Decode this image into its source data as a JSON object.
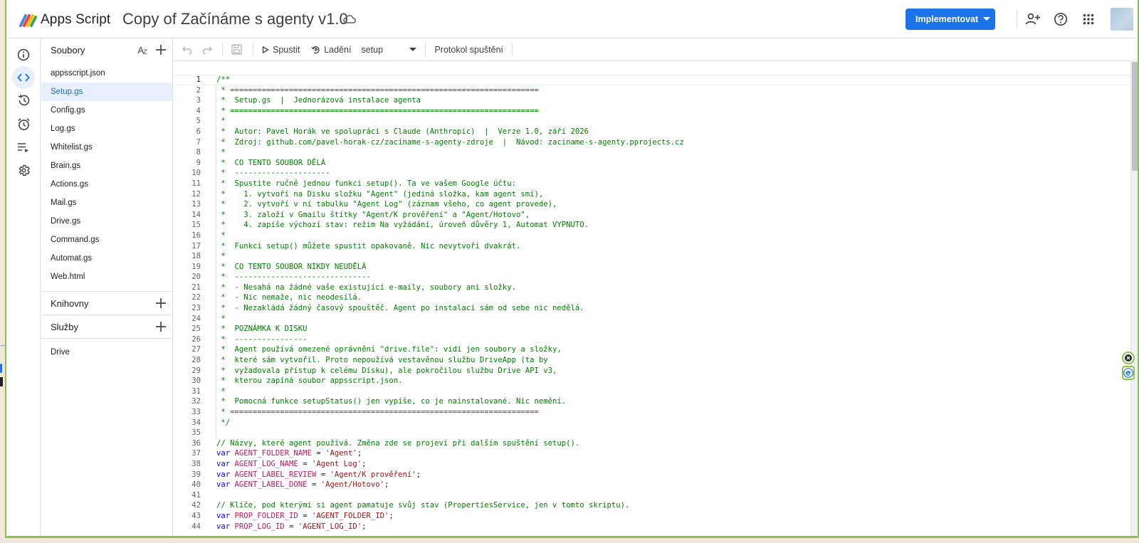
{
  "header": {
    "brand": "Apps Script",
    "project_title": "Copy of Začínáme s agenty v1.0",
    "deploy_label": "Implementovat"
  },
  "files_panel": {
    "title": "Soubory",
    "files": [
      "appsscript.json",
      "Setup.gs",
      "Config.gs",
      "Log.gs",
      "Whitelist.gs",
      "Brain.gs",
      "Actions.gs",
      "Mail.gs",
      "Drive.gs",
      "Command.gs",
      "Automat.gs",
      "Web.html"
    ],
    "active_file": "Setup.gs",
    "libraries_label": "Knihovny",
    "services_label": "Služby",
    "services": [
      "Drive"
    ]
  },
  "toolbar": {
    "run_label": "Spustit",
    "debug_label": "Ladění",
    "function_selected": "setup",
    "log_label": "Protokol spuštění"
  },
  "editor": {
    "current_line": 1,
    "line_numbers": [
      "1",
      "2",
      "3",
      "4",
      "5",
      "6",
      "7",
      "8",
      "9",
      "10",
      "11",
      "12",
      "13",
      "14",
      "15",
      "16",
      "17",
      "18",
      "19",
      "20",
      "21",
      "22",
      "23",
      "24",
      "25",
      "26",
      "27",
      "28",
      "29",
      "30",
      "31",
      "32",
      "33",
      "34",
      "35",
      "36",
      "37",
      "38",
      "39",
      "40",
      "41",
      "42",
      "43",
      "44"
    ],
    "comment_lines": [
      "/**",
      " * ====================================================================",
      " *  Setup.gs  |  Jednorázová instalace agenta",
      " * ====================================================================",
      " *",
      " *  Autor: Pavel Horák ve spolupráci s Claude (Anthropic)  |  Verze 1.0, září 2026",
      " *  Zdroj: github.com/pavel-horak-cz/zaciname-s-agenty-zdroje  |  Návod: zaciname-s-agenty.pprojects.cz",
      " *",
      " *  CO TENTO SOUBOR DĚLÁ",
      " *  ---------------------",
      " *  Spustite ručně jednou funkci setup(). Ta ve vašem Google účtu:",
      " *    1. vytvoří na Disku složku \"Agent\" (jediná složka, kam agent smí),",
      " *    2. vytvoří v ní tabulku \"Agent Log\" (záznam všeho, co agent provede),",
      " *    3. založí v Gmailu štítky \"Agent/K prověření\" a \"Agent/Hotovo\",",
      " *    4. zapíše výchozí stav: režim Na vyžádání, úroveň důvěry 1, Automat VYPNUTO.",
      " *",
      " *  Funkci setup() můžete spustit opakovaně. Nic nevytvoří dvakrát.",
      " *",
      " *  CO TENTO SOUBOR NIKDY NEUDĚLÁ",
      " *  ------------------------------",
      " *  - Nesahá na žádné vaše existující e-maily, soubory ani složky.",
      " *  - Nic nemaže, nic neodesílá.",
      " *  - Nezakládá žádný časový spouštěč. Agent po instalaci sám od sebe nic nedělá.",
      " *",
      " *  POZNÁMKA K DISKU",
      " *  ----------------",
      " *  Agent používá omezené oprávnění \"drive.file\": vidí jen soubory a složky,",
      " *  které sám vytvořil. Proto nepoužívá vestavěnou službu DriveApp (ta by",
      " *  vyžadovala přístup k celému Disku), ale pokročilou službu Drive API v3,",
      " *  kterou zapíná soubor appsscript.json.",
      " *",
      " *  Pomocná funkce setupStatus() jen vypíše, co je nainstalované. Nic nemění.",
      " * ====================================================================",
      " */",
      ""
    ],
    "comment_36": "// Názvy, které agent používá. Změna zde se projeví při dalším spuštění setup().",
    "vars_1": [
      {
        "kw": "var",
        "name": "AGENT_FOLDER_NAME",
        "value": "'Agent'"
      },
      {
        "kw": "var",
        "name": "AGENT_LOG_NAME",
        "value": "'Agent Log'"
      },
      {
        "kw": "var",
        "name": "AGENT_LABEL_REVIEW",
        "value": "'Agent/K prověření'"
      },
      {
        "kw": "var",
        "name": "AGENT_LABEL_DONE",
        "value": "'Agent/Hotovo'"
      }
    ],
    "comment_42": "// Klíče, pod kterými si agent pamatuje svůj stav (PropertiesService, jen v tomto skriptu).",
    "vars_2": [
      {
        "kw": "var",
        "name": "PROP_FOLDER_ID",
        "value": "'AGENT_FOLDER_ID'"
      },
      {
        "kw": "var",
        "name": "PROP_LOG_ID",
        "value": "'AGENT_LOG_ID'"
      }
    ]
  },
  "colors": {
    "accent": "#1a73e8",
    "comment": "#008000",
    "keyword": "#0000ff",
    "variable": "#c1185f",
    "string": "#a31515",
    "selection": "#e8f0fe",
    "extension_border": "#8bc34a"
  },
  "icons": {
    "rail": [
      "info-icon",
      "code-icon",
      "history-icon",
      "alarm-icon",
      "executions-icon",
      "settings-icon"
    ],
    "top": [
      "add-person-icon",
      "help-icon",
      "apps-grid-icon"
    ]
  }
}
